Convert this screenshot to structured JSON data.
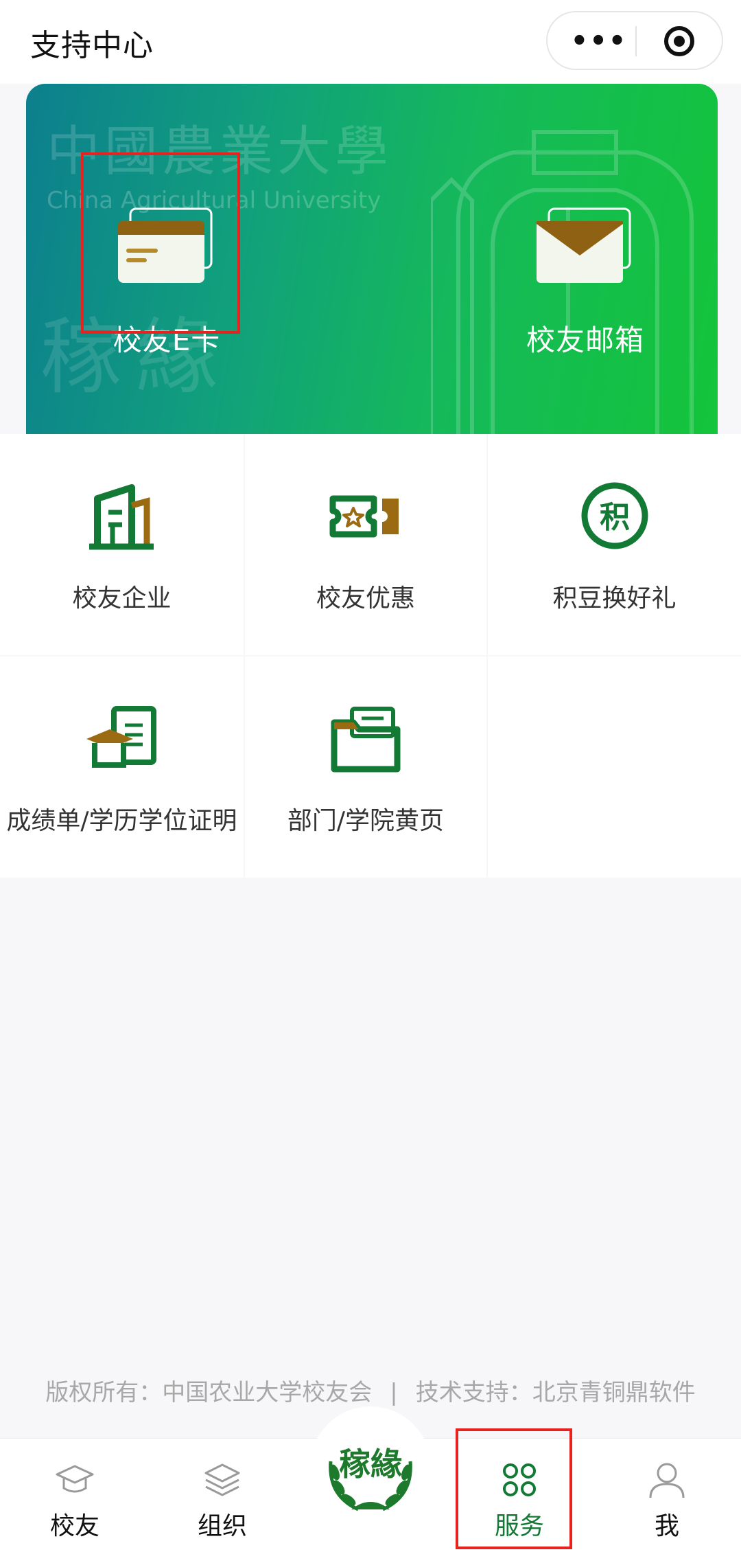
{
  "header": {
    "title": "支持中心",
    "more_glyph": "•••"
  },
  "banner": {
    "watermark_cn": "中國農業大學",
    "watermark_en": "China Agricultural University",
    "watermark_seal": "稼緣",
    "items": [
      {
        "label": "校友E卡",
        "icon": "card-icon"
      },
      {
        "label": "校友邮箱",
        "icon": "envelope-icon"
      }
    ]
  },
  "services": [
    {
      "label": "校友企业",
      "icon": "building-icon"
    },
    {
      "label": "校友优惠",
      "icon": "ticket-icon"
    },
    {
      "label": "积豆换好礼",
      "icon": "points-icon",
      "icon_char": "积"
    },
    {
      "label": "成绩单/学历学位证明",
      "icon": "graduation-certificate-icon"
    },
    {
      "label": "部门/学院黄页",
      "icon": "folder-icon"
    }
  ],
  "footer": {
    "copyright": "版权所有：中国农业大学校友会",
    "divider": "|",
    "support": "技术支持：北京青铜鼎软件"
  },
  "tabbar": {
    "items": [
      {
        "label": "校友",
        "icon": "graduation-cap-icon"
      },
      {
        "label": "组织",
        "icon": "layers-icon"
      },
      {
        "label": "服务",
        "icon": "grid-clover-icon",
        "active": true
      },
      {
        "label": "我",
        "icon": "user-icon"
      }
    ],
    "center_logo_text": "稼緣"
  },
  "colors": {
    "brand_green": "#137a35",
    "brand_gold": "#9a6b12",
    "highlight_red": "#e8231f"
  }
}
